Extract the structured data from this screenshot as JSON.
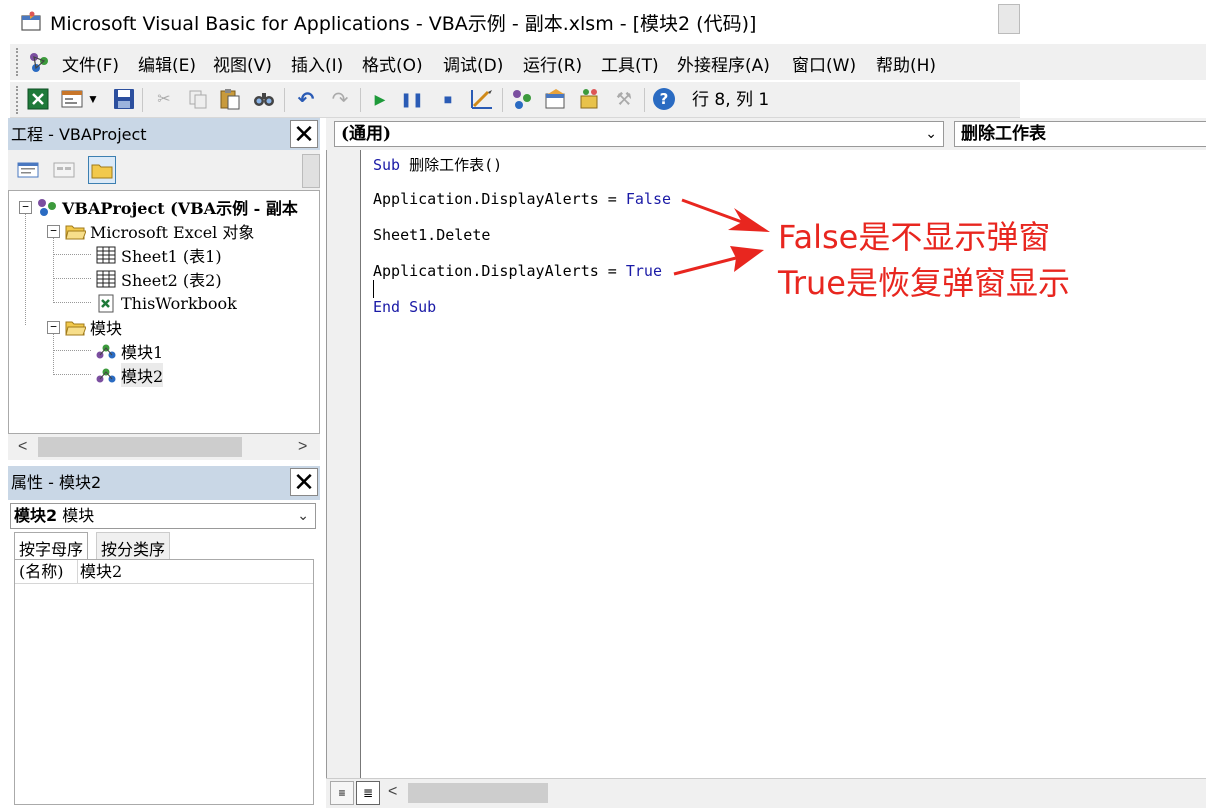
{
  "window": {
    "title": "Microsoft Visual Basic for Applications - VBA示例 - 副本.xlsm - [模块2 (代码)]"
  },
  "menu": {
    "items": [
      "文件(F)",
      "编辑(E)",
      "视图(V)",
      "插入(I)",
      "格式(O)",
      "调试(D)",
      "运行(R)",
      "工具(T)",
      "外接程序(A)",
      "窗口(W)",
      "帮助(H)"
    ]
  },
  "toolbar": {
    "status": "行 8, 列 1"
  },
  "project_pane": {
    "title": "工程 - VBAProject",
    "close": "✕",
    "tree": {
      "root": "VBAProject (VBA示例 - 副本",
      "excel_objects": "Microsoft Excel 对象",
      "sheet1": "Sheet1 (表1)",
      "sheet2": "Sheet2 (表2)",
      "thisworkbook": "ThisWorkbook",
      "modules": "模块",
      "module1": "模块1",
      "module2": "模块2"
    }
  },
  "properties_pane": {
    "title": "属性 - 模块2",
    "close": "✕",
    "object_name": "模块2",
    "object_type": "模块",
    "tabs": [
      "按字母序",
      "按分类序"
    ],
    "rows": [
      {
        "key": "(名称)",
        "value": "模块2"
      }
    ]
  },
  "code_window": {
    "object_combo": "(通用)",
    "procedure_combo": "删除工作表",
    "lines": {
      "l1_kw": "Sub",
      "l1_rest": " 删除工作表()",
      "l2_text": "Application.DisplayAlerts = ",
      "l2_kw": "False",
      "l3_text": "Sheet1.Delete",
      "l4_text": "Application.DisplayAlerts = ",
      "l4_kw": "True",
      "l5_kw": "End Sub"
    }
  },
  "annotations": {
    "line1": "False是不显示弹窗",
    "line2": "True是恢复弹窗显示",
    "color": "#e8261f"
  }
}
